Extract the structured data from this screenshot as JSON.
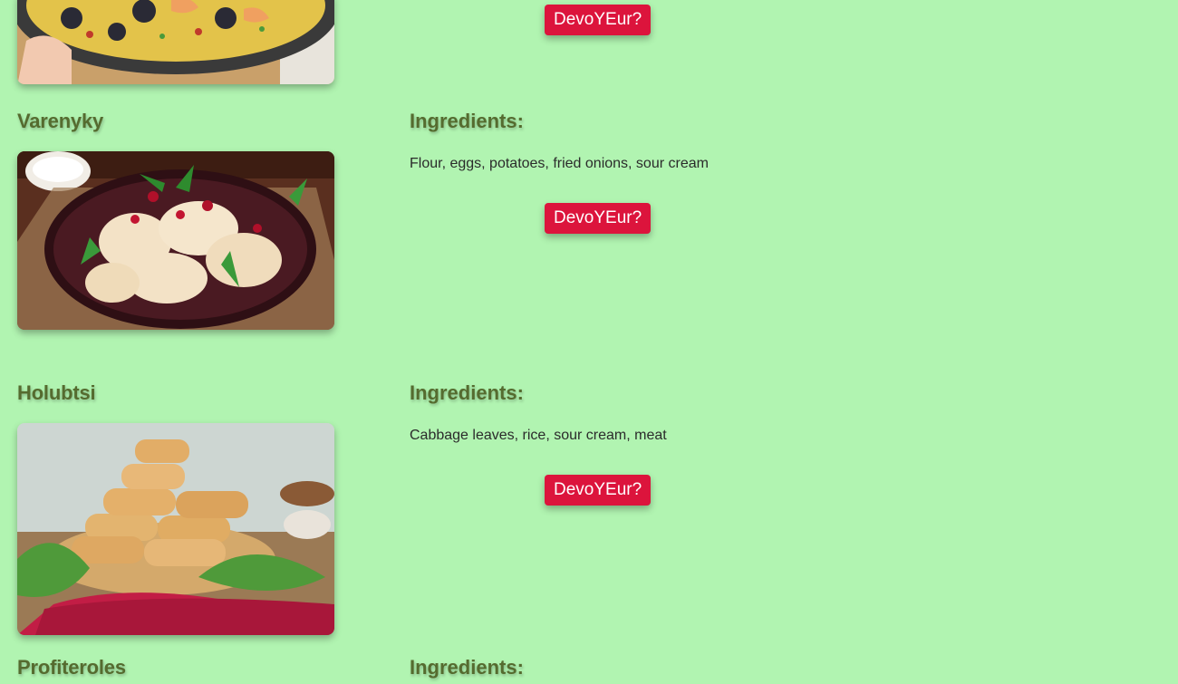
{
  "colors": {
    "background": "#b1f4b1",
    "heading": "#556b2f",
    "button": "#dc143c",
    "button_text": "#ffffff"
  },
  "dishes": [
    {
      "name": "",
      "image": "paella-image",
      "button_label": "DevoYEur?"
    },
    {
      "name": "Varenyky",
      "ingredients_heading": "Ingredients:",
      "ingredients": "Flour, eggs, potatoes, fried onions, sour cream",
      "image": "varenyky-image",
      "button_label": "DevoYEur?"
    },
    {
      "name": "Holubtsi",
      "ingredients_heading": "Ingredients:",
      "ingredients": "Cabbage leaves, rice, sour cream, meat",
      "image": "holubtsi-image",
      "button_label": "DevoYEur?"
    },
    {
      "name": "Profiteroles",
      "ingredients_heading": "Ingredients:"
    }
  ]
}
